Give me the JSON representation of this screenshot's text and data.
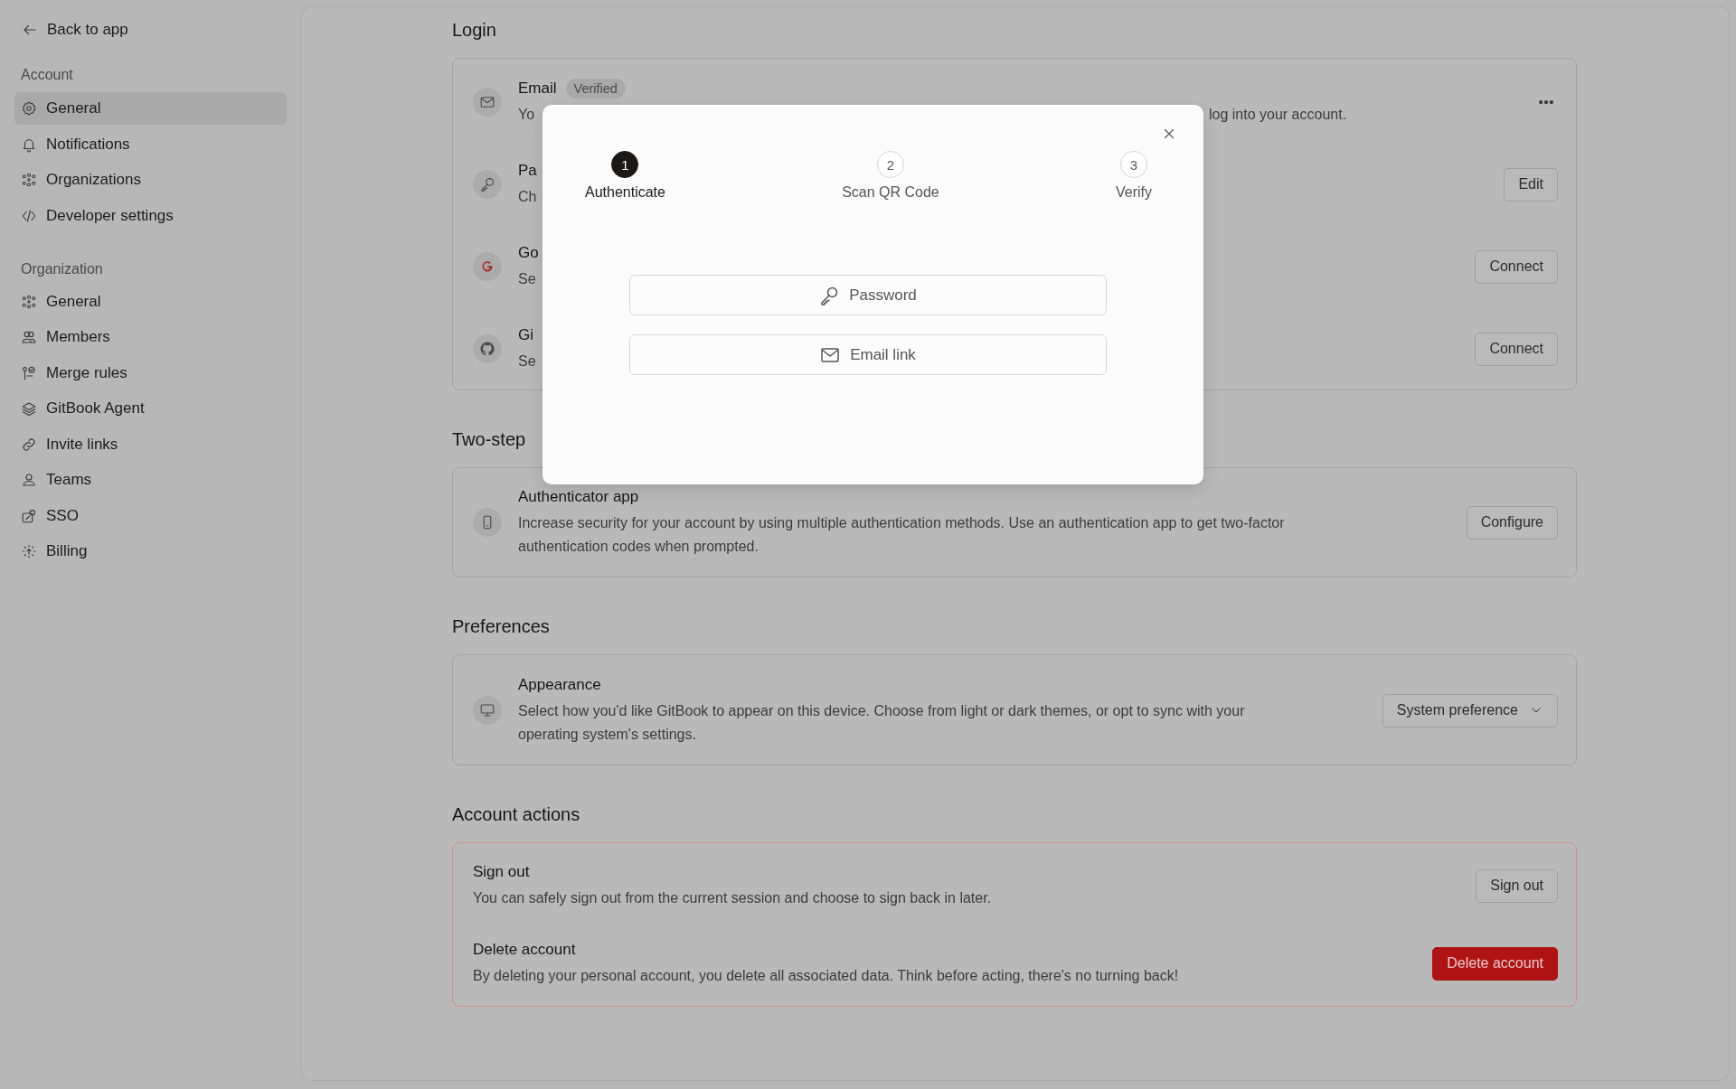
{
  "sidebar": {
    "back_link": "Back to app",
    "sections": [
      {
        "title": "Account",
        "items": [
          {
            "label": "General",
            "selected": true
          },
          {
            "label": "Notifications",
            "selected": false
          },
          {
            "label": "Organizations",
            "selected": false
          },
          {
            "label": "Developer settings",
            "selected": false
          }
        ]
      },
      {
        "title": "Organization",
        "items": [
          {
            "label": "General",
            "selected": false
          },
          {
            "label": "Members",
            "selected": false
          },
          {
            "label": "Merge rules",
            "selected": false
          },
          {
            "label": "GitBook Agent",
            "selected": false
          },
          {
            "label": "Invite links",
            "selected": false
          },
          {
            "label": "Teams",
            "selected": false
          },
          {
            "label": "SSO",
            "selected": false
          },
          {
            "label": "Billing",
            "selected": false
          }
        ]
      }
    ]
  },
  "sections": [
    {
      "heading": "Login",
      "danger": false,
      "rows": [
        {
          "title": "Email",
          "badge": "Verified",
          "description": "Yo",
          "description_tail": "log into your account.",
          "action": {
            "kind": "menu"
          }
        },
        {
          "title": "Pa",
          "description": "Ch",
          "action": {
            "kind": "button",
            "label": "Edit"
          }
        },
        {
          "title": "Go",
          "description": "Se",
          "action": {
            "kind": "button",
            "label": "Connect"
          }
        },
        {
          "title": "Gi",
          "description": "Se",
          "action": {
            "kind": "button",
            "label": "Connect"
          }
        }
      ]
    },
    {
      "heading": "Two-step",
      "danger": false,
      "rows": [
        {
          "title": "Authenticator app",
          "description": "Increase security for your account by using multiple authentication methods. Use an authentication app to get two-factor authentication codes when prompted.",
          "action": {
            "kind": "button",
            "label": "Configure"
          }
        }
      ]
    },
    {
      "heading": "Preferences",
      "danger": false,
      "rows": [
        {
          "title": "Appearance",
          "description": "Select how you'd like GitBook to appear on this device. Choose from light or dark themes, or opt to sync with your operating system's settings.",
          "action": {
            "kind": "dropdown",
            "label": "System preference"
          }
        }
      ]
    },
    {
      "heading": "Account actions",
      "danger": true,
      "rows": [
        {
          "title": "Sign out",
          "description": "You can safely sign out from the current session and choose to sign back in later.",
          "action": {
            "kind": "button",
            "label": "Sign out"
          }
        },
        {
          "title": "Delete account",
          "description": "By deleting your personal account, you delete all associated data. Think before acting, there's no turning back!",
          "action": {
            "kind": "danger",
            "label": "Delete account"
          }
        }
      ]
    }
  ],
  "modal": {
    "steps": [
      {
        "number": "1",
        "label": "Authenticate",
        "selected": true
      },
      {
        "number": "2",
        "label": "Scan QR Code",
        "selected": false
      },
      {
        "number": "3",
        "label": "Verify",
        "selected": false
      }
    ],
    "options": [
      "Password",
      "Email link"
    ]
  }
}
